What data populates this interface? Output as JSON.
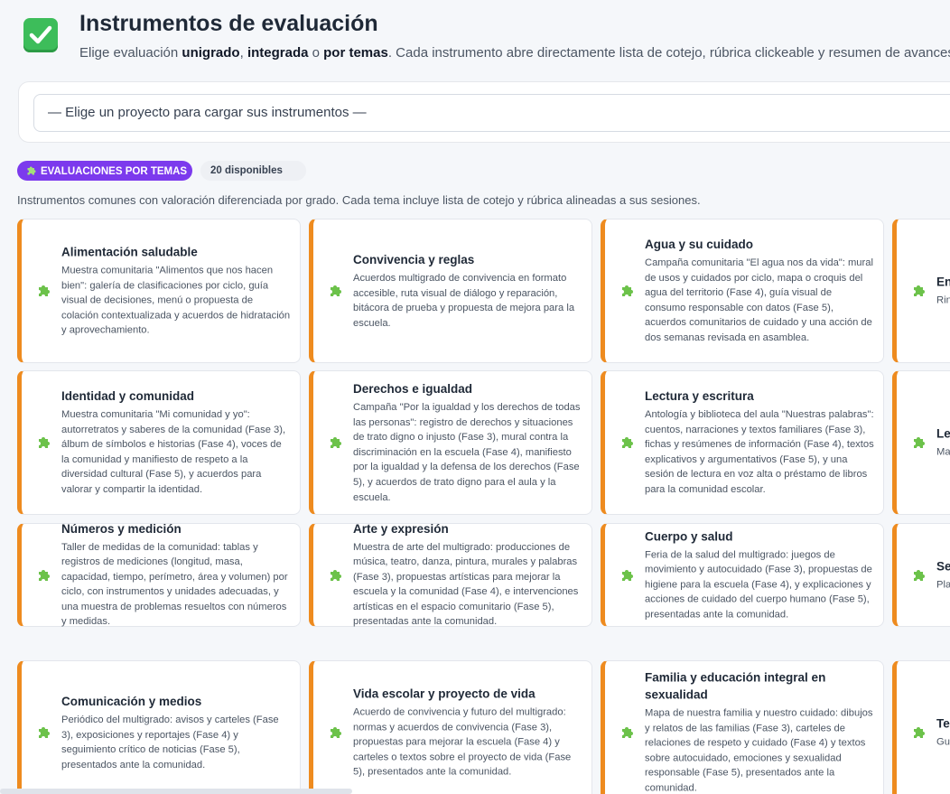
{
  "header": {
    "title": "Instrumentos de evaluación",
    "subtitle_prefix": "Elige evaluación ",
    "subtitle_b1": "unigrado",
    "subtitle_sep1": ", ",
    "subtitle_b2": "integrada",
    "subtitle_sep2": " o ",
    "subtitle_b3": "por temas",
    "subtitle_suffix": ". Cada instrumento abre directamente lista de cotejo, rúbrica clickeable y resumen de avances",
    "icon": "check-icon"
  },
  "project_select": {
    "placeholder": "— Elige un proyecto para cargar sus instrumentos —"
  },
  "section": {
    "badge_label": "EVALUACIONES POR TEMAS",
    "count_label": "20 disponibles",
    "intro": "Instrumentos comunes con valoración diferenciada por grado. Cada tema incluye lista de cotejo y rúbrica alineadas a sus sesiones."
  },
  "colors": {
    "accent_orange": "#ee8b1f",
    "badge_purple": "#7c3aed",
    "puzzle_green": "#6cc24a",
    "check_green": "#3dbd5a"
  },
  "cards": [
    {
      "title": "Alimentación saludable",
      "text": "Muestra comunitaria \"Alimentos que nos hacen bien\": galería de clasificaciones por ciclo, guía visual de decisiones, menú o propuesta de colación contextualizada y acuerdos de hidratación y aprovechamiento."
    },
    {
      "title": "Convivencia y reglas",
      "text": "Acuerdos multigrado de convivencia en formato accesible, ruta visual de diálogo y reparación, bitácora de prueba y propuesta de mejora para la escuela."
    },
    {
      "title": "Agua y su cuidado",
      "text": "Campaña comunitaria \"El agua nos da vida\": mural de usos y cuidados por ciclo, mapa o croquis del agua del territorio (Fase 4), guía visual de consumo responsable con datos (Fase 5), acuerdos comunitarios de cuidado y una acción de dos semanas revisada en asamblea."
    },
    {
      "title": "En",
      "text": "Rin aut ter rut her era"
    },
    {
      "title": "Identidad y comunidad",
      "text": "Muestra comunitaria \"Mi comunidad y yo\": autorretratos y saberes de la comunidad (Fase 3), álbum de símbolos e historias (Fase 4), voces de la comunidad y manifiesto de respeto a la diversidad cultural (Fase 5), y acuerdos para valorar y compartir la identidad."
    },
    {
      "title": "Derechos e igualdad",
      "text": "Campaña \"Por la igualdad y los derechos de todas las personas\": registro de derechos y situaciones de trato digno o injusto (Fase 3), mural contra la discriminación en la escuela (Fase 4), manifiesto por la igualdad y la defensa de los derechos (Fase 5), y acuerdos de trato digno para el aula y la escuela."
    },
    {
      "title": "Lectura y escritura",
      "text": "Antología y biblioteca del aula \"Nuestras palabras\": cuentos, narraciones y textos familiares (Fase 3), fichas y resúmenes de información (Fase 4), textos explicativos y argumentativos (Fase 5), y una sesión de lectura en voz alta o préstamo de libros para la comunidad escolar."
    },
    {
      "title": "Le",
      "text": "Ma con dis ling la c inte"
    },
    {
      "title": "Números y medición",
      "text": "Taller de medidas de la comunidad: tablas y registros de mediciones (longitud, masa, capacidad, tiempo, perímetro, área y volumen) por ciclo, con instrumentos y unidades adecuadas, y una muestra de problemas resueltos con números y medidas."
    },
    {
      "title": "Arte y expresión",
      "text": "Muestra de arte del multigrado: producciones de música, teatro, danza, pintura, murales y palabras (Fase 3), propuestas artísticas para mejorar la escuela y la comunidad (Fase 4), e intervenciones artísticas en el espacio comunitario (Fase 5), presentadas ante la comunidad."
    },
    {
      "title": "Cuerpo y salud",
      "text": "Feria de la salud del multigrado: juegos de movimiento y autocuidado (Fase 3), propuestas de higiene para la escuela (Fase 4), y explicaciones y acciones de cuidado del cuerpo humano (Fase 5), presentadas ante la comunidad."
    },
    {
      "title": "Se",
      "text": "Pla acc esc pre car gén"
    },
    {
      "title": "Comunicación y medios",
      "text": "Periódico del multigrado: avisos y carteles (Fase 3), exposiciones y reportajes (Fase 4) y seguimiento crítico de noticias (Fase 5), presentados ante la comunidad."
    },
    {
      "title": "Vida escolar y proyecto de vida",
      "text": "Acuerdo de convivencia y futuro del multigrado: normas y acuerdos de convivencia (Fase 3), propuestas para mejorar la escuela (Fase 4) y carteles o textos sobre el proyecto de vida (Fase 5), presentados ante la comunidad."
    },
    {
      "title": "Familia y educación integral en sexualidad",
      "text": "Mapa de nuestra familia y nuestro cuidado: dibujos y relatos de las familias (Fase 3), carteles de relaciones de respeto y cuidado (Fase 4) y textos sobre autocuidado, emociones y sexualidad responsable (Fase 5), presentados ante la comunidad."
    },
    {
      "title": "Te",
      "text": "Gu sob (Fa ries y s dig con"
    }
  ]
}
